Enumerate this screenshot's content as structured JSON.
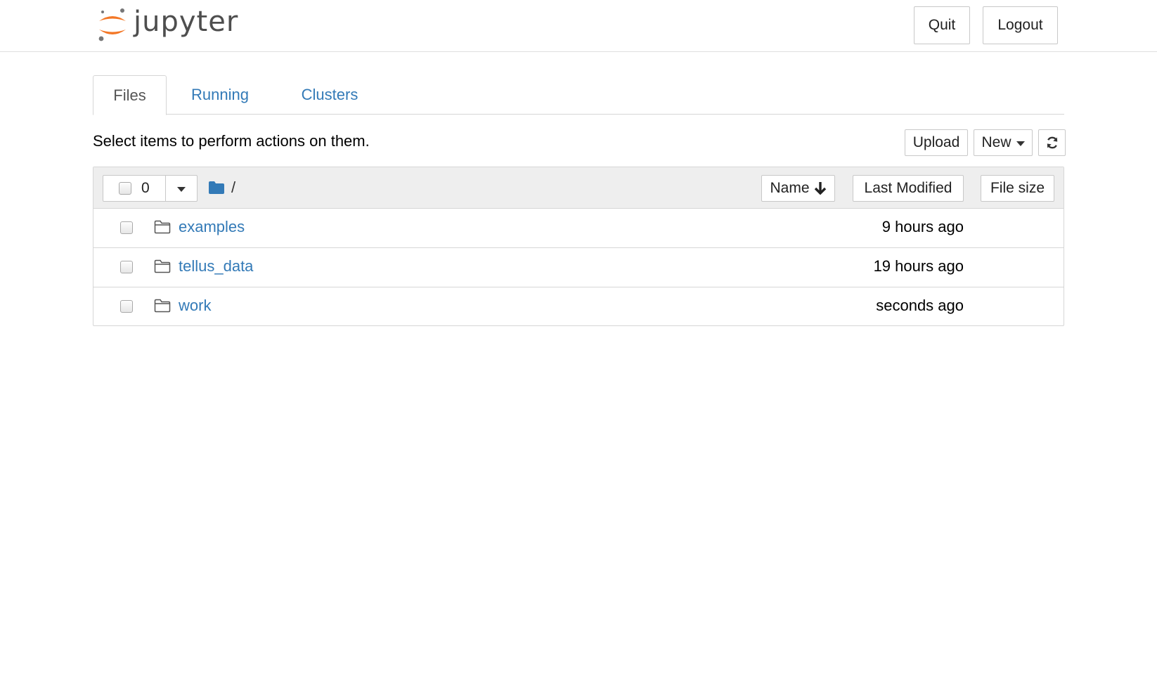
{
  "header": {
    "logo_text": "jupyter",
    "quit_label": "Quit",
    "logout_label": "Logout"
  },
  "tabs": [
    {
      "label": "Files",
      "active": true
    },
    {
      "label": "Running",
      "active": false
    },
    {
      "label": "Clusters",
      "active": false
    }
  ],
  "toolbar": {
    "info_text": "Select items to perform actions on them.",
    "upload_label": "Upload",
    "new_label": "New"
  },
  "list_header": {
    "selected_count": "0",
    "breadcrumb": "/",
    "sort_name_label": "Name",
    "sort_modified_label": "Last Modified",
    "sort_size_label": "File size"
  },
  "items": [
    {
      "name": "examples",
      "modified": "9 hours ago"
    },
    {
      "name": "tellus_data",
      "modified": "19 hours ago"
    },
    {
      "name": "work",
      "modified": "seconds ago"
    }
  ],
  "colors": {
    "link": "#337ab7",
    "logo_orange": "#f37726",
    "logo_gray": "#767677",
    "header_bg": "#eeeeee"
  }
}
